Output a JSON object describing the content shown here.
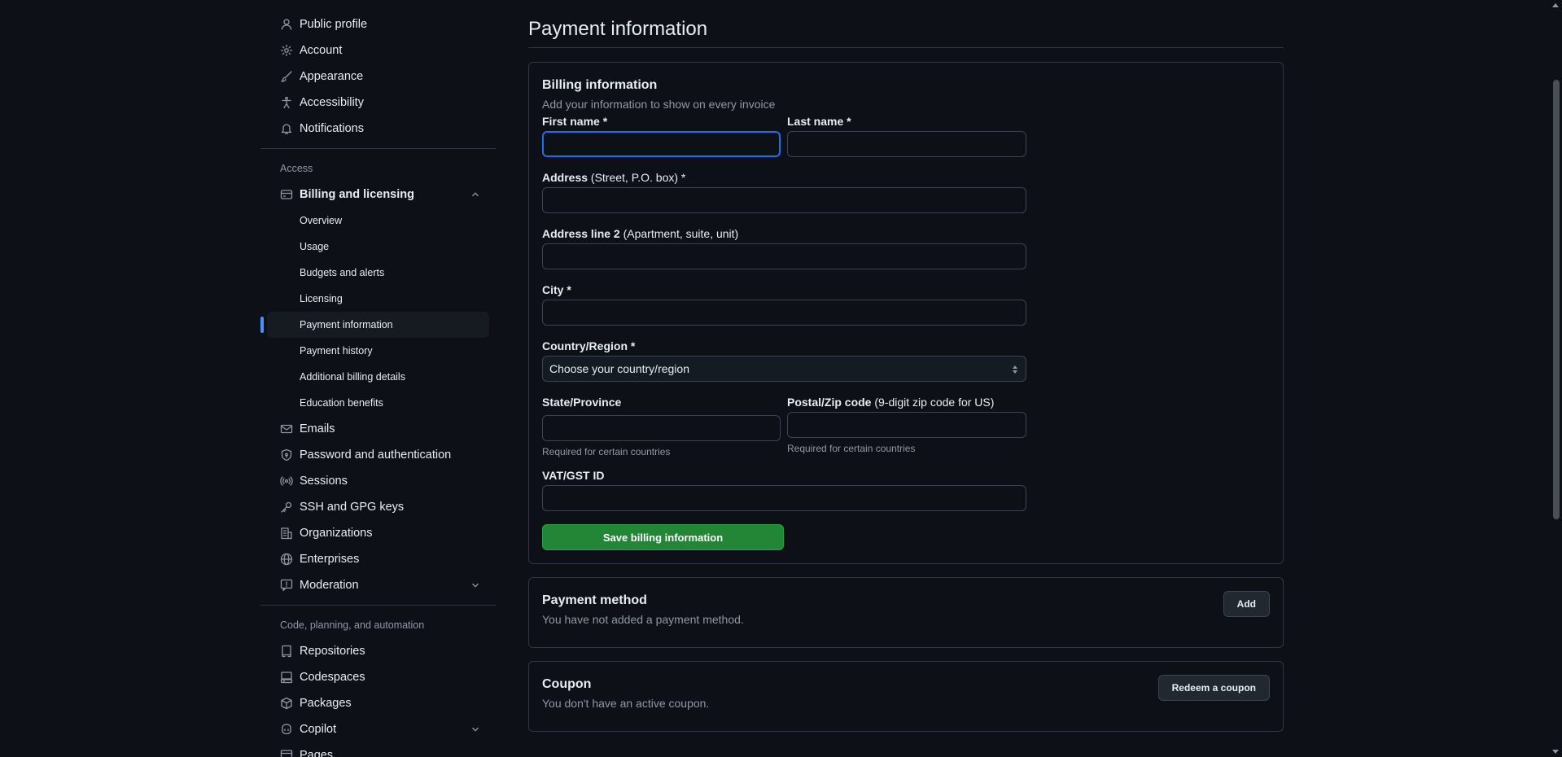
{
  "sidebar": {
    "top_items": [
      {
        "label": "Public profile",
        "icon": "person-icon"
      },
      {
        "label": "Account",
        "icon": "gear-icon"
      },
      {
        "label": "Appearance",
        "icon": "paintbrush-icon"
      },
      {
        "label": "Accessibility",
        "icon": "accessibility-icon"
      },
      {
        "label": "Notifications",
        "icon": "bell-icon"
      }
    ],
    "access_heading": "Access",
    "billing": {
      "label": "Billing and licensing",
      "sub_items": [
        "Overview",
        "Usage",
        "Budgets and alerts",
        "Licensing",
        "Payment information",
        "Payment history",
        "Additional billing details",
        "Education benefits"
      ],
      "active": "Payment information"
    },
    "access_items": [
      {
        "label": "Emails",
        "icon": "mail-icon"
      },
      {
        "label": "Password and authentication",
        "icon": "shield-lock-icon"
      },
      {
        "label": "Sessions",
        "icon": "broadcast-icon"
      },
      {
        "label": "SSH and GPG keys",
        "icon": "key-icon"
      },
      {
        "label": "Organizations",
        "icon": "organization-icon"
      },
      {
        "label": "Enterprises",
        "icon": "globe-icon"
      },
      {
        "label": "Moderation",
        "icon": "report-icon"
      }
    ],
    "code_heading": "Code, planning, and automation",
    "code_items": [
      {
        "label": "Repositories",
        "icon": "repo-icon"
      },
      {
        "label": "Codespaces",
        "icon": "codespaces-icon"
      },
      {
        "label": "Packages",
        "icon": "package-icon"
      },
      {
        "label": "Copilot",
        "icon": "copilot-icon"
      },
      {
        "label": "Pages",
        "icon": "browser-icon"
      }
    ]
  },
  "main": {
    "title": "Payment information",
    "billing": {
      "heading": "Billing information",
      "description": "Add your information to show on every invoice",
      "first_name_label": "First name *",
      "last_name_label": "Last name *",
      "address_label": "Address",
      "address_note": "(Street, P.O. box) *",
      "address2_label": "Address line 2",
      "address2_note": "(Apartment, suite, unit)",
      "city_label": "City *",
      "country_label": "Country/Region *",
      "country_value": "Choose your country/region",
      "state_label": "State/Province",
      "state_hint": "Required for certain countries",
      "postal_label": "Postal/Zip code",
      "postal_note": "(9-digit zip code for US)",
      "postal_hint": "Required for certain countries",
      "vat_label": "VAT/GST ID",
      "save_button": "Save billing information"
    },
    "payment_method": {
      "heading": "Payment method",
      "description": "You have not added a payment method.",
      "add_button": "Add"
    },
    "coupon": {
      "heading": "Coupon",
      "description": "You don't have an active coupon.",
      "redeem_button": "Redeem a coupon"
    }
  },
  "colors": {
    "background": "#0d1117",
    "border": "#30363d",
    "accent": "#4493f8",
    "focus": "#1f6feb",
    "primary_button": "#238636",
    "muted_text": "#9198a1"
  }
}
